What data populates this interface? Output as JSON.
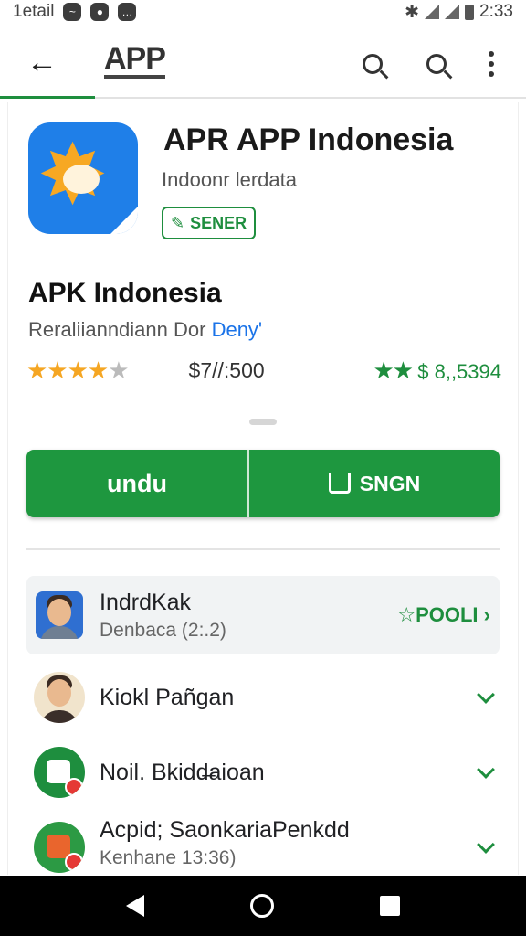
{
  "status_bar": {
    "carrier": "1etail",
    "time": "2:33"
  },
  "app_bar": {
    "title": "APP",
    "back_icon": "arrow-back-icon",
    "search_icon": "search-icon",
    "menu_icon": "more-vert-icon"
  },
  "app": {
    "name": "APR APP Indonesia",
    "developer": "Indoonr lerdata",
    "badge_label": "SENER",
    "badge_icon": "edit-icon",
    "icon_color": "#1f7fe8"
  },
  "details": {
    "title": "APK Indonesia",
    "subtitle_prefix": "Reraliianndiann Dor",
    "subtitle_link": "Deny'",
    "rating_stars": 4,
    "rating_max": 5,
    "price": "$7//:500",
    "green_stars": "★★",
    "green_value": "$ 8,,5394"
  },
  "actions": {
    "primary_label": "undu",
    "secondary_label": "SNGN",
    "accent_color": "#1e973f"
  },
  "list": {
    "items": [
      {
        "title": "IndrdKak",
        "subtitle": "Denbaca (2:.2)",
        "action": "☆POOLI ›"
      },
      {
        "title": "Kiokl Pañgan",
        "subtitle": ""
      },
      {
        "title": "Noil. Bkidd̶aioan",
        "subtitle": ""
      },
      {
        "title": "Acpid; SaonkariaPenkdd",
        "subtitle": "Kenhane 13:36)"
      }
    ]
  }
}
